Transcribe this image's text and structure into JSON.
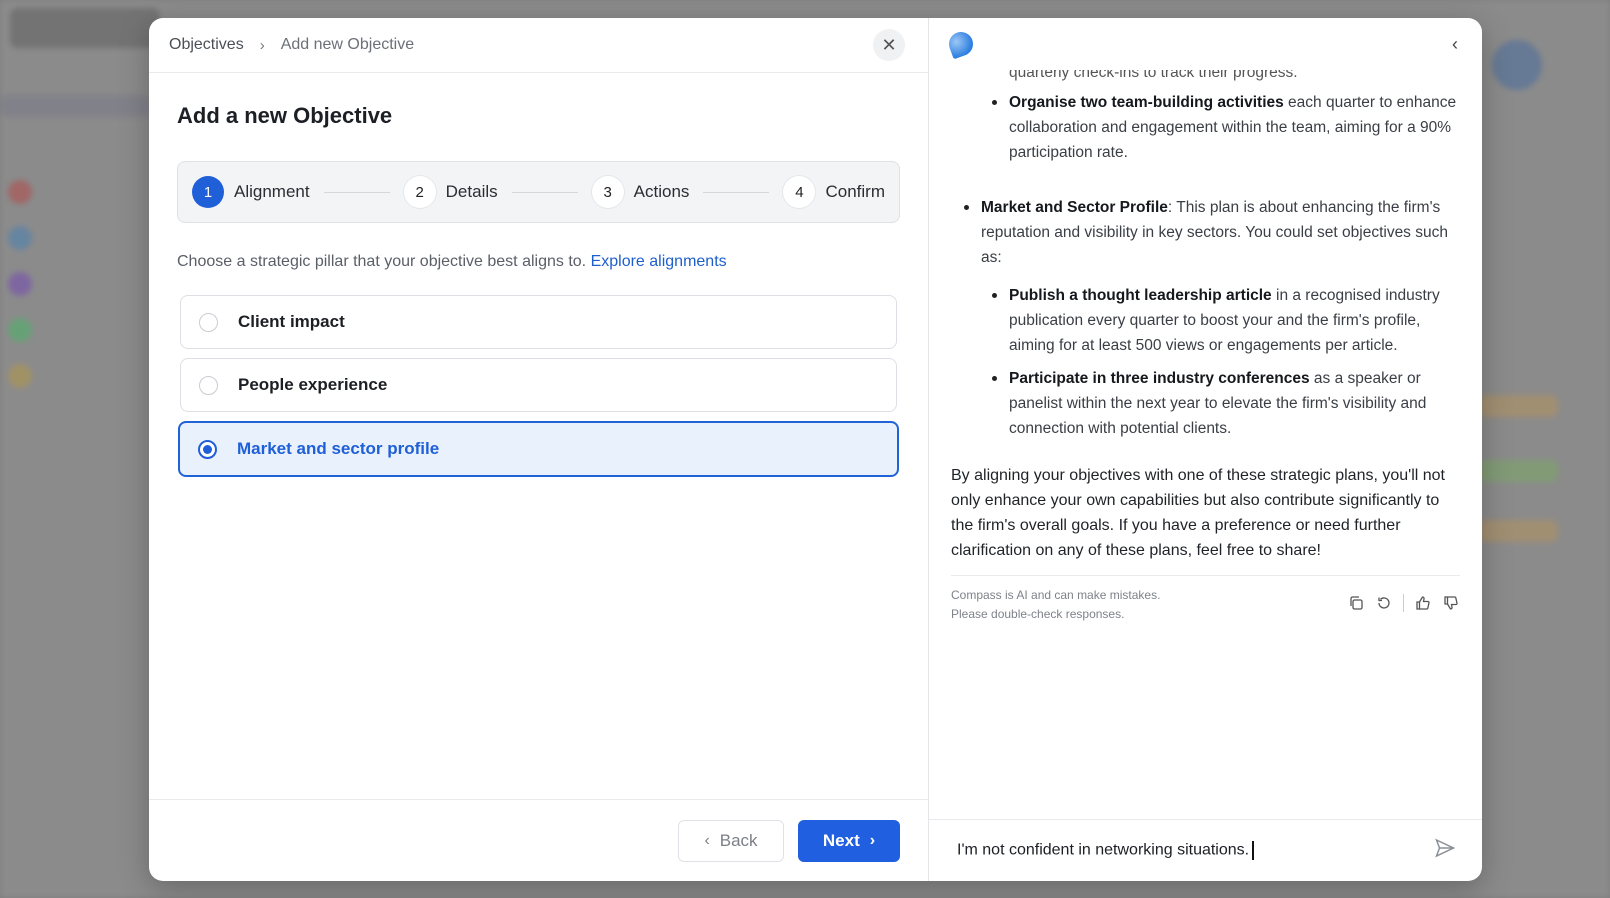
{
  "breadcrumb": {
    "root": "Objectives",
    "current": "Add new Objective"
  },
  "modal_title": "Add a new Objective",
  "steps": [
    {
      "num": "1",
      "label": "Alignment"
    },
    {
      "num": "2",
      "label": "Details"
    },
    {
      "num": "3",
      "label": "Actions"
    },
    {
      "num": "4",
      "label": "Confirm"
    }
  ],
  "hint": {
    "text": "Choose a strategic pillar that your objective best aligns to.",
    "link": "Explore alignments"
  },
  "options": [
    {
      "label": "Client impact",
      "selected": false
    },
    {
      "label": "People experience",
      "selected": false
    },
    {
      "label": "Market and sector profile",
      "selected": true
    }
  ],
  "footer": {
    "back_label": "Back",
    "next_label": "Next"
  },
  "chat": {
    "cut_line": "quarterly check-ins to track their progress.",
    "item_team_bold": "Organise two team-building activities",
    "item_team_rest": " each quarter to enhance collaboration and engagement within the team, aiming for a 90% participation rate.",
    "section_bold": "Market and Sector Profile",
    "section_rest": ": This plan is about enhancing the firm's reputation and visibility in key sectors. You could set objectives such as:",
    "item1_bold": "Publish a thought leadership article",
    "item1_rest": " in a recognised industry publication every quarter to boost your and the firm's profile, aiming for at least 500 views or engagements per article.",
    "item2_bold": "Participate in three industry conferences",
    "item2_rest": " as a speaker or panelist within the next year to elevate the firm's visibility and connection with potential clients.",
    "closing": "By aligning your objectives with one of these strategic plans, you'll not only enhance your own capabilities but also contribute significantly to the firm's overall goals. If you have a preference or need further clarification on any of these plans, feel free to share!",
    "disclaimer_line1": "Compass is AI and can make mistakes.",
    "disclaimer_line2": "Please double-check responses.",
    "input_value": "I'm not confident in networking situations."
  },
  "colors": {
    "primary": "#1f5fe0",
    "selected_bg": "#e9f1fc"
  }
}
